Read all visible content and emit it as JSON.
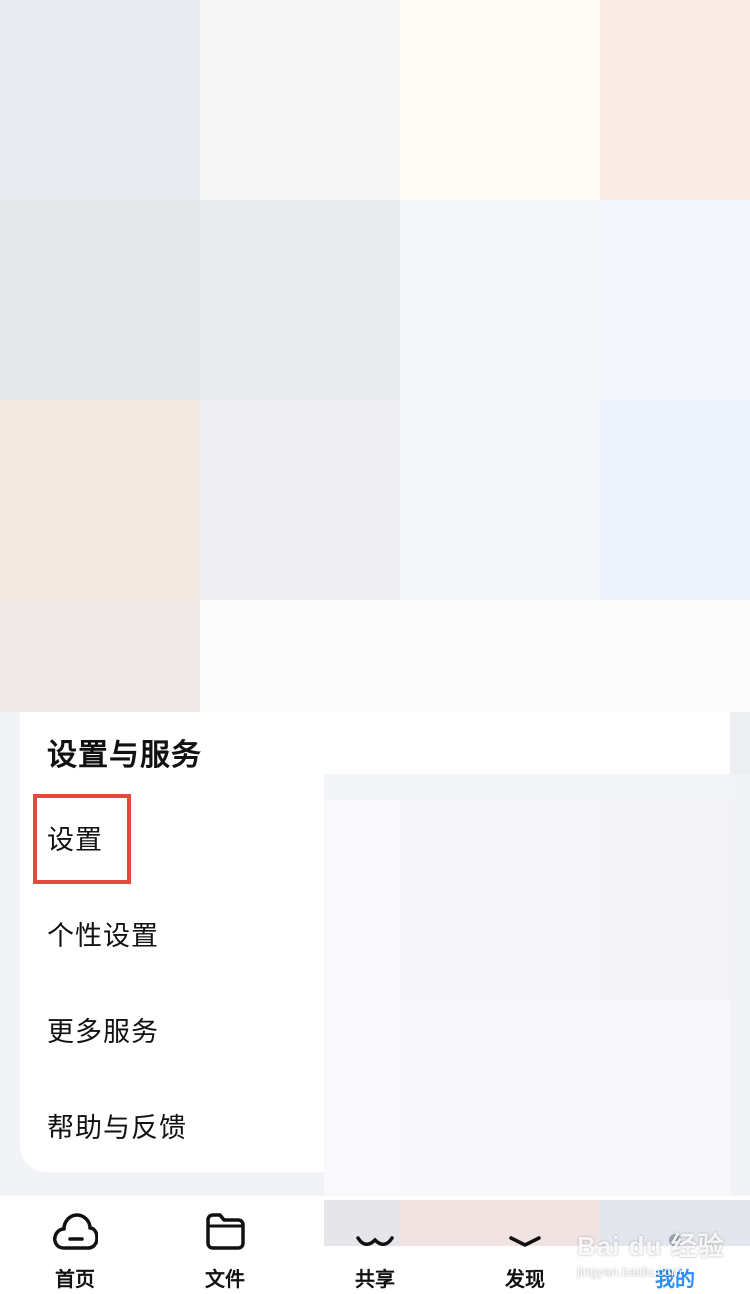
{
  "section": {
    "title": "设置与服务",
    "items": [
      {
        "label": "设置",
        "highlighted": true
      },
      {
        "label": "个性设置"
      },
      {
        "label": "更多服务"
      },
      {
        "label": "帮助与反馈"
      }
    ]
  },
  "tabbar": {
    "tabs": [
      {
        "label": "首页",
        "icon": "cloud-icon"
      },
      {
        "label": "文件",
        "icon": "folder-icon"
      },
      {
        "label": "共享",
        "icon": "share-icon"
      },
      {
        "label": "发现",
        "icon": "discover-icon"
      },
      {
        "label": "我的",
        "icon": "profile-icon",
        "active": true
      }
    ],
    "active_color": "#2b8ef5"
  },
  "highlight_color": "#e8473d",
  "watermark": {
    "logo": "Bai du 经验",
    "url": "jingyan.baidu.com"
  }
}
